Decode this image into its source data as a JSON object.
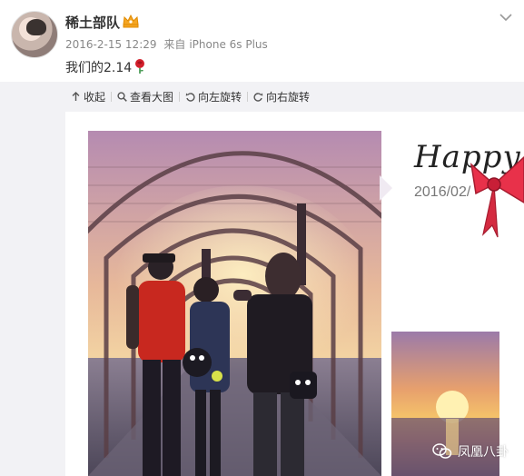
{
  "post": {
    "username": "稀土部队",
    "badge_icon": "vip-crown-icon",
    "timestamp": "2016-2-15 12:29",
    "source_prefix": "来自",
    "source_device": "iPhone 6s Plus",
    "text": "我们的2.14",
    "emoji_icon": "rose-icon"
  },
  "toolbar": {
    "collapse_label": "收起",
    "view_large_label": "查看大图",
    "rotate_left_label": "向左旋转",
    "rotate_right_label": "向右旋转"
  },
  "collage": {
    "happy_text": "Happy",
    "date_text": "2016/02/",
    "bow_color": "#e8314a"
  },
  "watermark": {
    "label": "凤凰八卦",
    "icon": "wechat-icon"
  },
  "colors": {
    "background": "#f2f2f5",
    "text_meta": "#888888",
    "text_main": "#333333"
  }
}
